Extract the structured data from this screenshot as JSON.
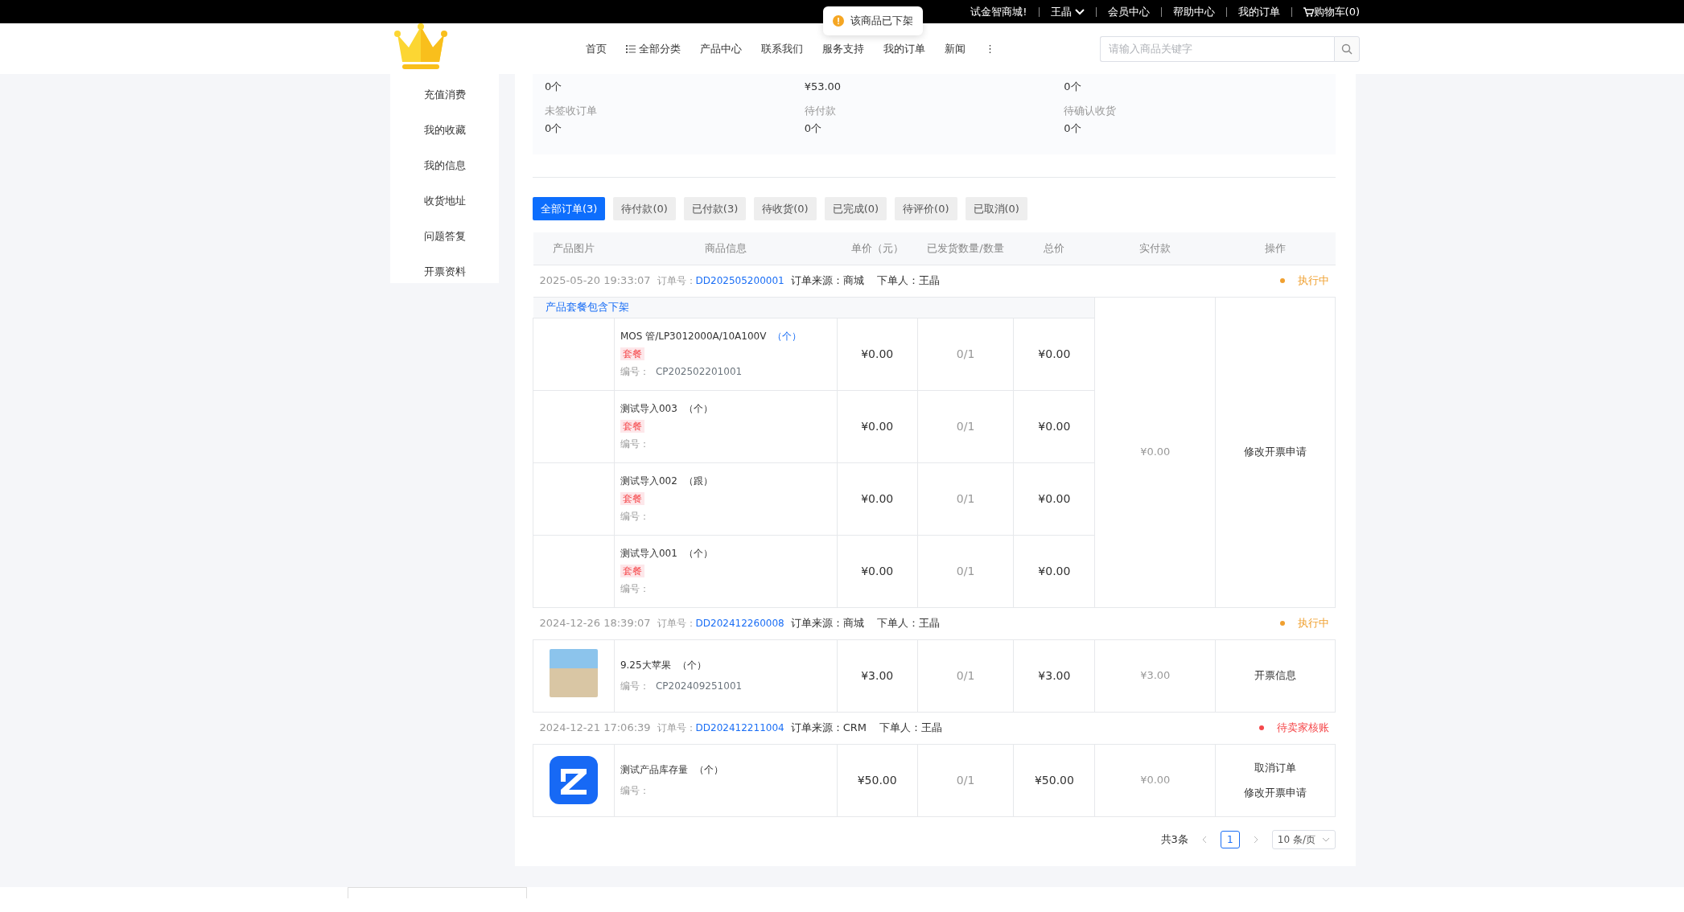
{
  "top_bar": {
    "welcome": "试金智商城!",
    "user": "王晶",
    "links": [
      {
        "label": "会员中心",
        "kind": "text"
      },
      {
        "label": "帮助中心",
        "kind": "text"
      },
      {
        "label": "我的订单",
        "kind": "text"
      },
      {
        "label": "购物车(0)",
        "kind": "cart"
      }
    ]
  },
  "toast": {
    "text": "该商品已下架"
  },
  "nav": {
    "items": [
      {
        "label": "首页",
        "kind": "text"
      },
      {
        "label": "全部分类",
        "kind": "list"
      },
      {
        "label": "产品中心",
        "kind": "text"
      },
      {
        "label": "联系我们",
        "kind": "text"
      },
      {
        "label": "服务支持",
        "kind": "text"
      },
      {
        "label": "我的订单",
        "kind": "text"
      },
      {
        "label": "新闻",
        "kind": "text"
      },
      {
        "label": "⋮",
        "kind": "text"
      }
    ],
    "search": {
      "placeholder": "请输入商品关键字"
    }
  },
  "sidebar": {
    "items": [
      "充值消费",
      "我的收藏",
      "我的信息",
      "收货地址",
      "问题答复",
      "开票资料"
    ]
  },
  "summary": [
    {
      "value": "0个"
    },
    {
      "value": "¥53.00"
    },
    {
      "value": "0个"
    },
    {
      "label": "未签收订单",
      "value": "0个"
    },
    {
      "label": "待付款",
      "value": "0个"
    },
    {
      "label": "待确认收货",
      "value": "0个"
    }
  ],
  "tabs": [
    {
      "label": "全部订单(3)",
      "selected": true
    },
    {
      "label": "待付款(0)",
      "selected": false
    },
    {
      "label": "已付款(3)",
      "selected": false
    },
    {
      "label": "待收货(0)",
      "selected": false
    },
    {
      "label": "已完成(0)",
      "selected": false
    },
    {
      "label": "待评价(0)",
      "selected": false
    },
    {
      "label": "已取消(0)",
      "selected": false
    }
  ],
  "table": {
    "columns": [
      "产品图片",
      "商品信息",
      "单价（元）",
      "已发货数量/数量",
      "总价",
      "实付款",
      "操作"
    ],
    "orders": [
      {
        "time": "2025-05-20 19:33:07",
        "order_no_label": "订单号：",
        "order_no": "DD202505200001",
        "source": "订单来源：商城",
        "placer": "下单人：王晶",
        "status": "执行中",
        "color": "#f0a030",
        "notice": "产品套餐包含下架",
        "paid": "¥0.00",
        "actions": [
          "修改开票申请"
        ],
        "items": [
          {
            "kind": "none",
            "name": "MOS 管/LP3012000A/10A100V",
            "unit": "（个）",
            "unit_highlight": true,
            "tag": "套餐",
            "code_label": "编号：",
            "code": "CP202502201001",
            "price": "¥0.00",
            "qty": "0/1",
            "total": "¥0.00"
          },
          {
            "kind": "none",
            "name": "测试导入003",
            "unit": "（个）",
            "unit_highlight": false,
            "tag": "套餐",
            "code_label": "编号：",
            "price": "¥0.00",
            "qty": "0/1",
            "total": "¥0.00"
          },
          {
            "kind": "none",
            "name": "测试导入002",
            "unit": "（跟）",
            "unit_highlight": false,
            "tag": "套餐",
            "code_label": "编号：",
            "price": "¥0.00",
            "qty": "0/1",
            "total": "¥0.00"
          },
          {
            "kind": "none",
            "name": "测试导入001",
            "unit": "（个）",
            "unit_highlight": false,
            "tag": "套餐",
            "code_label": "编号：",
            "price": "¥0.00",
            "qty": "0/1",
            "total": "¥0.00"
          }
        ]
      },
      {
        "time": "2024-12-26 18:39:07",
        "order_no_label": "订单号：",
        "order_no": "DD202412260008",
        "source": "订单来源：商城",
        "placer": "下单人：王晶",
        "status": "执行中",
        "color": "#f0a030",
        "paid": "¥3.00",
        "actions": [
          "开票信息"
        ],
        "items": [
          {
            "kind": "photo",
            "name": "9.25大苹果",
            "unit": "（个）",
            "unit_highlight": false,
            "code_label": "编号：",
            "code": "CP202409251001",
            "price": "¥3.00",
            "qty": "0/1",
            "total": "¥3.00"
          }
        ]
      },
      {
        "time": "2024-12-21 17:06:39",
        "order_no_label": "订单号：",
        "order_no": "DD202412211004",
        "source": "订单来源：CRM",
        "placer": "下单人：王晶",
        "status": "待卖家核账",
        "color": "#f5484b",
        "paid": "¥0.00",
        "actions": [
          "取消订单",
          "修改开票申请"
        ],
        "items": [
          {
            "kind": "logo",
            "name": "测试产品库存量",
            "unit": "（个）",
            "unit_highlight": false,
            "code_label": "编号：",
            "price": "¥50.00",
            "qty": "0/1",
            "total": "¥50.00"
          }
        ]
      }
    ]
  },
  "pagination": {
    "total": "共3条",
    "pages": [
      {
        "label": "1",
        "selected": true
      }
    ],
    "page_size": "10 条/页"
  }
}
